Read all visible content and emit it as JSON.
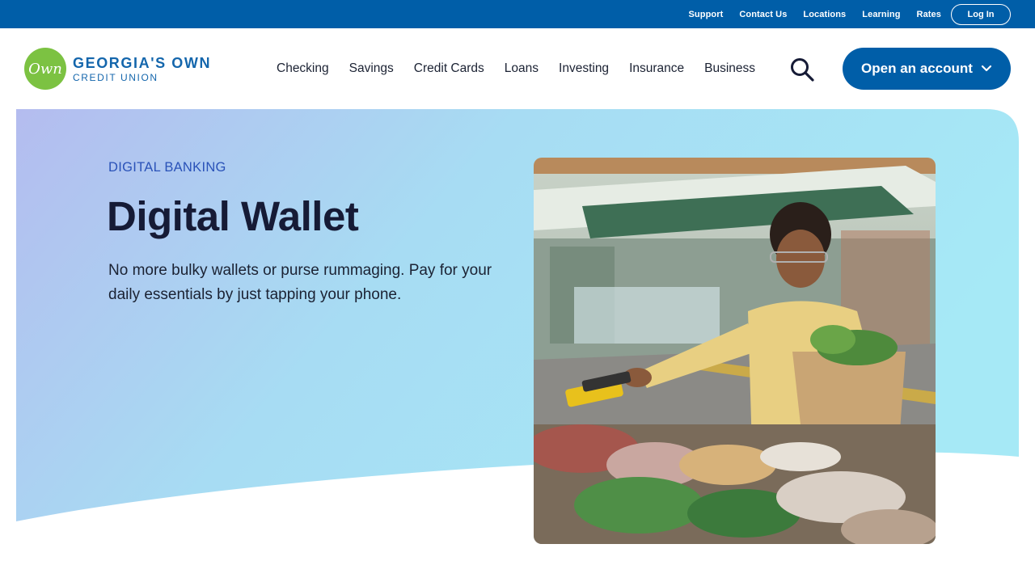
{
  "utility": {
    "links": [
      "Support",
      "Contact Us",
      "Locations",
      "Learning",
      "Rates"
    ],
    "login_label": "Log In"
  },
  "logo": {
    "mark": "Own",
    "line1": "GEORGIA'S OWN",
    "line2": "CREDIT UNION",
    "brand_green": "#7cc242",
    "brand_blue": "#1466ac"
  },
  "nav": {
    "items": [
      "Checking",
      "Savings",
      "Credit Cards",
      "Loans",
      "Investing",
      "Insurance",
      "Business"
    ],
    "search_icon": "search-icon",
    "cta_label": "Open an account",
    "cta_icon": "chevron-down-icon"
  },
  "hero": {
    "eyebrow": "DIGITAL BANKING",
    "title": "Digital Wallet",
    "description": "No more bulky wallets or purse rummaging. Pay for your daily essentials by just tapping your phone.",
    "gradient_start": "#b3bdf0",
    "gradient_end": "#a8e8f5"
  },
  "colors": {
    "primary": "#005ea8",
    "text_dark": "#161b36",
    "accent_blue": "#2a52b8"
  }
}
